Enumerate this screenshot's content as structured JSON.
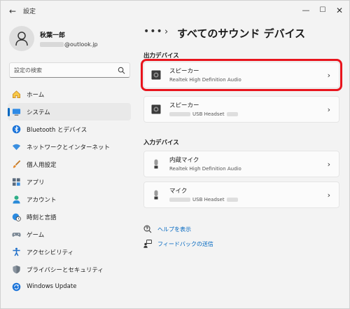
{
  "app": {
    "title": "設定"
  },
  "window_controls": {
    "back": "←",
    "minimize": "—",
    "maximize": "☐",
    "close": "✕"
  },
  "profile": {
    "name": "秋葉一郎",
    "email_domain": "@outlook.jp"
  },
  "search": {
    "placeholder": "設定の検索"
  },
  "sidebar": {
    "items": [
      {
        "label": "ホーム",
        "icon": "home-icon",
        "active": false
      },
      {
        "label": "システム",
        "icon": "system-icon",
        "active": true
      },
      {
        "label": "Bluetooth とデバイス",
        "icon": "bluetooth-icon",
        "active": false
      },
      {
        "label": "ネットワークとインターネット",
        "icon": "wifi-icon",
        "active": false
      },
      {
        "label": "個人用設定",
        "icon": "brush-icon",
        "active": false
      },
      {
        "label": "アプリ",
        "icon": "apps-icon",
        "active": false
      },
      {
        "label": "アカウント",
        "icon": "account-icon",
        "active": false
      },
      {
        "label": "時刻と言語",
        "icon": "globe-clock-icon",
        "active": false
      },
      {
        "label": "ゲーム",
        "icon": "gamepad-icon",
        "active": false
      },
      {
        "label": "アクセシビリティ",
        "icon": "accessibility-icon",
        "active": false
      },
      {
        "label": "プライバシーとセキュリティ",
        "icon": "shield-icon",
        "active": false
      },
      {
        "label": "Windows Update",
        "icon": "update-icon",
        "active": false
      }
    ]
  },
  "breadcrumb": {
    "more": "•••",
    "separator": "›",
    "title": "すべてのサウンド デバイス"
  },
  "output": {
    "title": "出力デバイス",
    "devices": [
      {
        "name": "スピーカー",
        "sub": "Realtek High Definition Audio",
        "icon": "speaker-icon"
      },
      {
        "name": "スピーカー",
        "sub": "USB Headset",
        "icon": "speaker-icon"
      }
    ]
  },
  "input": {
    "title": "入力デバイス",
    "devices": [
      {
        "name": "内蔵マイク",
        "sub": "Realtek High Definition Audio",
        "icon": "microphone-icon"
      },
      {
        "name": "マイク",
        "sub": "USB Headset",
        "icon": "microphone-icon"
      }
    ]
  },
  "links": {
    "help": "ヘルプを表示",
    "feedback": "フィードバックの送信"
  },
  "colors": {
    "accent": "#0067c0",
    "highlight": "#e8141d",
    "background": "#f3f3f3"
  }
}
